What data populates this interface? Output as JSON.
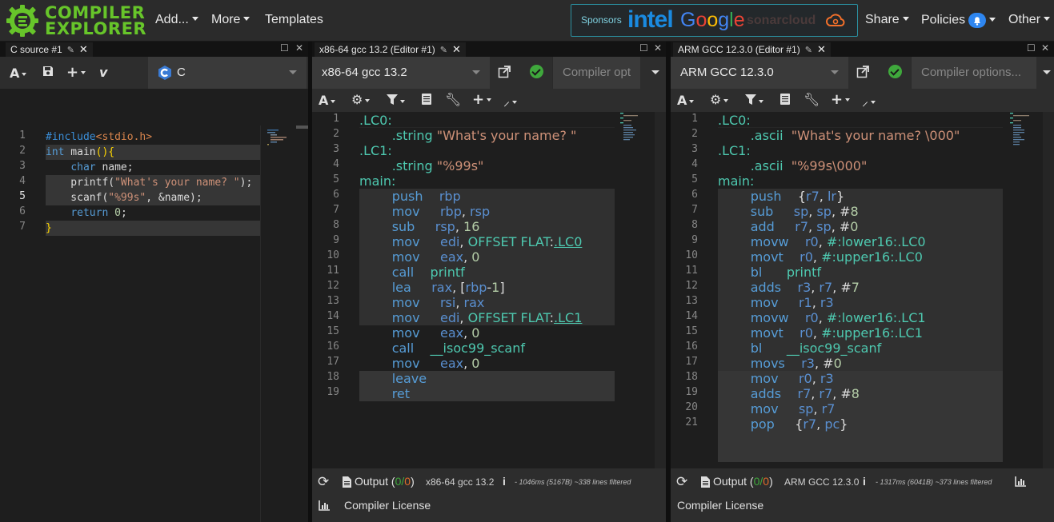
{
  "navbar": {
    "logo_line1": "COMPILER",
    "logo_line2": "EXPLORER",
    "add": "Add...",
    "more": "More",
    "templates": "Templates",
    "sponsors_label": "Sponsors",
    "sponsor_intel": "intel",
    "sponsor_google": "Google",
    "sponsor_sonar": "sonarcloud",
    "share": "Share",
    "policies": "Policies",
    "other": "Other"
  },
  "source_pane": {
    "tab_title": "C source #1",
    "language": "C",
    "lines": [
      "#include<stdio.h>",
      "int main(){",
      "    char name;",
      "    printf(\"What's your name? \");",
      "    scanf(\"%99s\", &name);",
      "    return 0;",
      "}"
    ]
  },
  "compiler_x86": {
    "tab_title": "x86-64 gcc 13.2 (Editor #1)",
    "compiler_name": "x86-64 gcc 13.2",
    "options_placeholder": "Compiler opt",
    "output_label": "Output (",
    "output_zero": "0",
    "output_sep": "/",
    "output_count": "0",
    "output_close": ")",
    "compiler_short": "x86-64 gcc 13.2",
    "stats": "- 1046ms (5167B) ~338 lines filtered",
    "license": "Compiler License"
  },
  "compiler_arm": {
    "tab_title": "ARM GCC 12.3.0 (Editor #1)",
    "compiler_name": "ARM GCC 12.3.0",
    "options_placeholder": "Compiler options...",
    "output_label": "Output (",
    "output_zero": "0",
    "output_sep": "/",
    "output_count": "0",
    "output_close": ")",
    "compiler_short": "ARM GCC 12.3.0",
    "stats": "- 1317ms (6041B) ~373 lines filtered",
    "license": "Compiler License"
  },
  "colors": {
    "accent_green": "#67c52a",
    "success": "#3fa83c",
    "link_blue": "#2e86f0"
  }
}
